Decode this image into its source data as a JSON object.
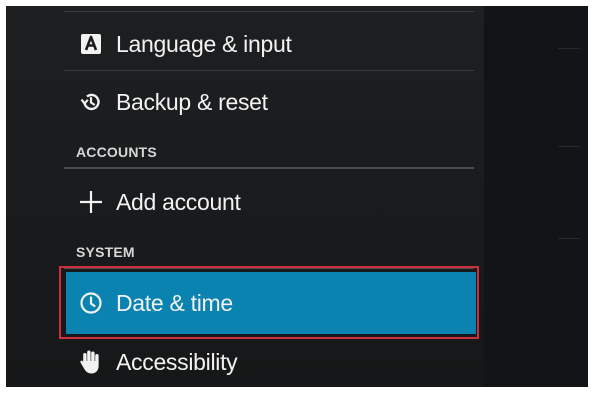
{
  "settings": {
    "items": [
      {
        "label": "Language & input",
        "icon": "language-icon"
      },
      {
        "label": "Backup & reset",
        "icon": "backup-reset-icon"
      }
    ],
    "sections": {
      "accounts": {
        "header": "ACCOUNTS",
        "items": [
          {
            "label": "Add account",
            "icon": "plus-icon"
          }
        ]
      },
      "system": {
        "header": "SYSTEM",
        "items": [
          {
            "label": "Date & time",
            "icon": "clock-icon",
            "selected": true
          },
          {
            "label": "Accessibility",
            "icon": "hand-icon"
          }
        ]
      }
    }
  },
  "colors": {
    "background": "#1b1c1e",
    "selected": "#0a83b0",
    "highlight_border": "#cf2f3b",
    "text": "#f2f2f2",
    "header_text": "#d6d6d6"
  }
}
